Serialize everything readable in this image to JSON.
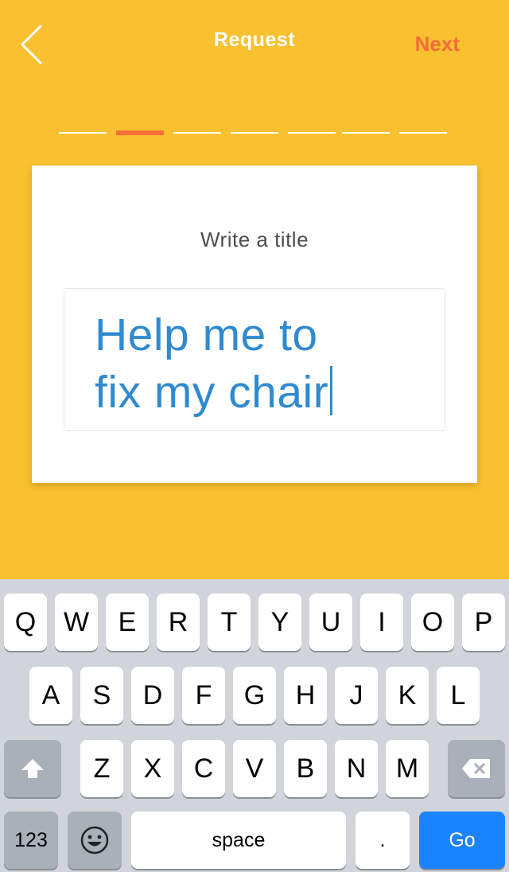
{
  "header": {
    "title": "Request",
    "next_label": "Next"
  },
  "progress": {
    "total_steps": 7,
    "current_step": 2
  },
  "card": {
    "prompt": "Write a title",
    "title_input": {
      "line1": "Help me to",
      "line2": "fix my chair"
    }
  },
  "keyboard": {
    "row1": [
      "Q",
      "W",
      "E",
      "R",
      "T",
      "Y",
      "U",
      "I",
      "O",
      "P"
    ],
    "row2": [
      "A",
      "S",
      "D",
      "F",
      "G",
      "H",
      "J",
      "K",
      "L"
    ],
    "row3": [
      "Z",
      "X",
      "C",
      "V",
      "B",
      "N",
      "M"
    ],
    "numbers_label": "123",
    "space_label": "space",
    "period_label": ".",
    "go_label": "Go"
  },
  "colors": {
    "background": "#f9c02f",
    "accent": "#f26b3a",
    "input_text": "#2f8ad0",
    "go_key": "#1a84ff"
  }
}
